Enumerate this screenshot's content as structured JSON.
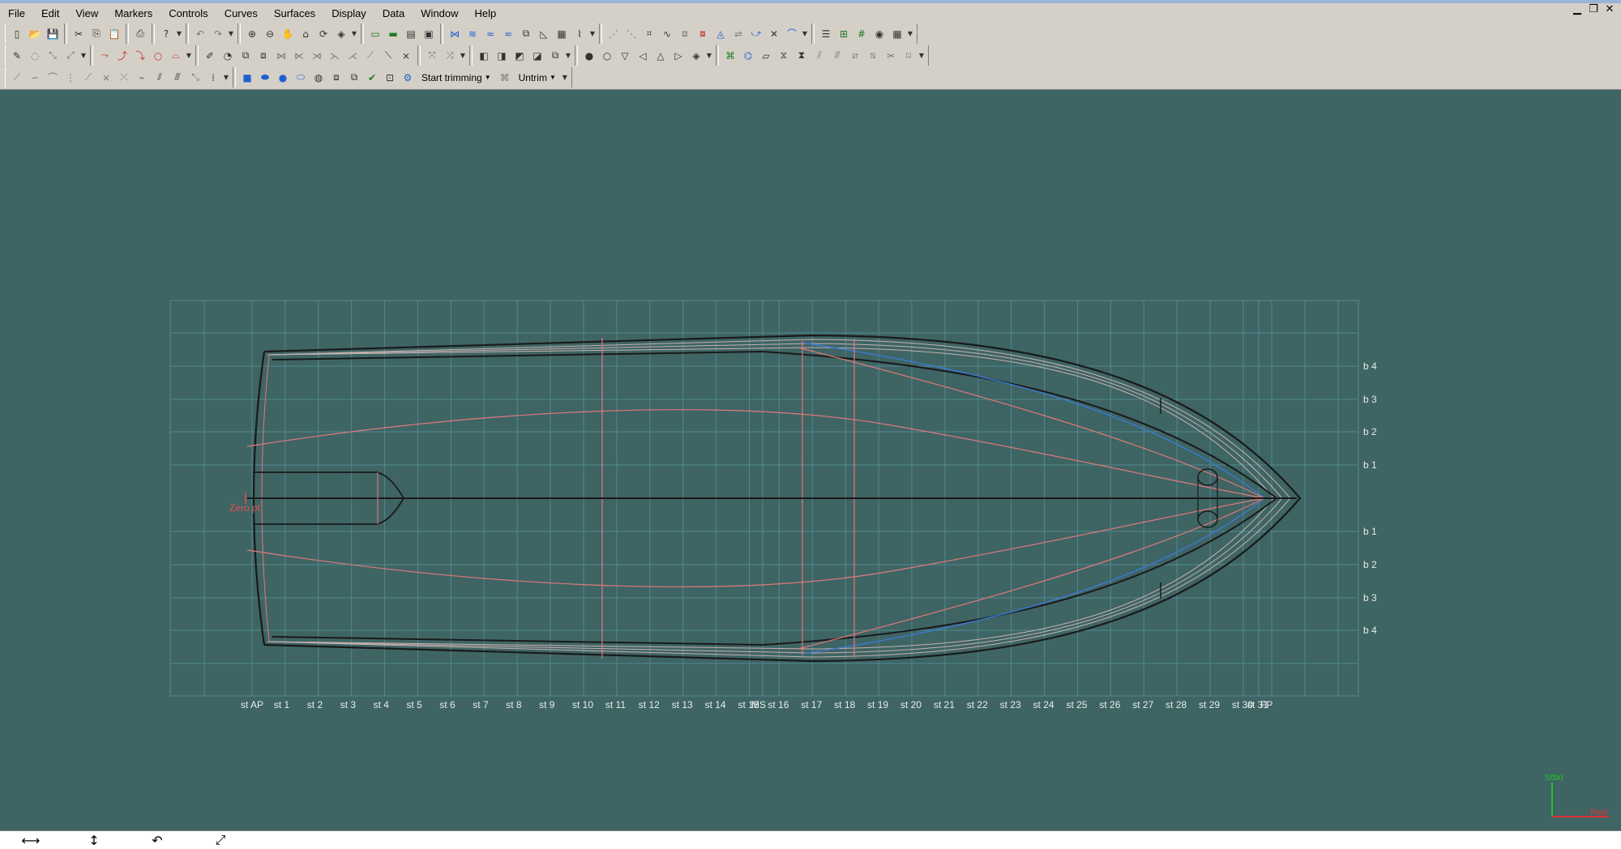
{
  "menubar": {
    "items": [
      "File",
      "Edit",
      "View",
      "Markers",
      "Controls",
      "Curves",
      "Surfaces",
      "Display",
      "Data",
      "Window",
      "Help"
    ]
  },
  "window_controls": {
    "minimize": "▁",
    "restore": "❐",
    "close": "✕"
  },
  "toolbar3": {
    "start_trimming_label": "Start trimming",
    "untrim_label": "Untrim"
  },
  "plan": {
    "zero_label": "Zero pt",
    "stations": [
      "st AP",
      "st 1",
      "st 2",
      "st 3",
      "st 4",
      "st 5",
      "st 6",
      "st 7",
      "st 8",
      "st 9",
      "st 10",
      "st 11",
      "st 12",
      "st 13",
      "st 14",
      "st 15",
      "MS",
      "st 16",
      "st 17",
      "st 18",
      "st 19",
      "st 20",
      "st 21",
      "st 22",
      "st 23",
      "st 24",
      "st 25",
      "st 26",
      "st 27",
      "st 28",
      "st 29",
      "st 30",
      "st 31",
      "FP"
    ],
    "buttocks": [
      "b 4",
      "b 3",
      "b 2",
      "b 1",
      "b 1",
      "b 2",
      "b 3",
      "b 4"
    ]
  },
  "axis_indicator": {
    "stbd": "Stbd",
    "fwd": "Fwd"
  },
  "colors": {
    "background": "#3f6464",
    "grid": "#4f8a92",
    "hull": "#1a1a1a",
    "contour": "#e07a7a",
    "blue": "#3a7bd5",
    "zero": "#e05050"
  },
  "statusbar": {
    "icons": [
      "pan-horizontal-icon",
      "pan-vertical-icon",
      "rotate-icon",
      "zoom-fit-icon"
    ],
    "glyphs": [
      "⟷",
      "↕",
      "↶",
      "⤢"
    ]
  }
}
